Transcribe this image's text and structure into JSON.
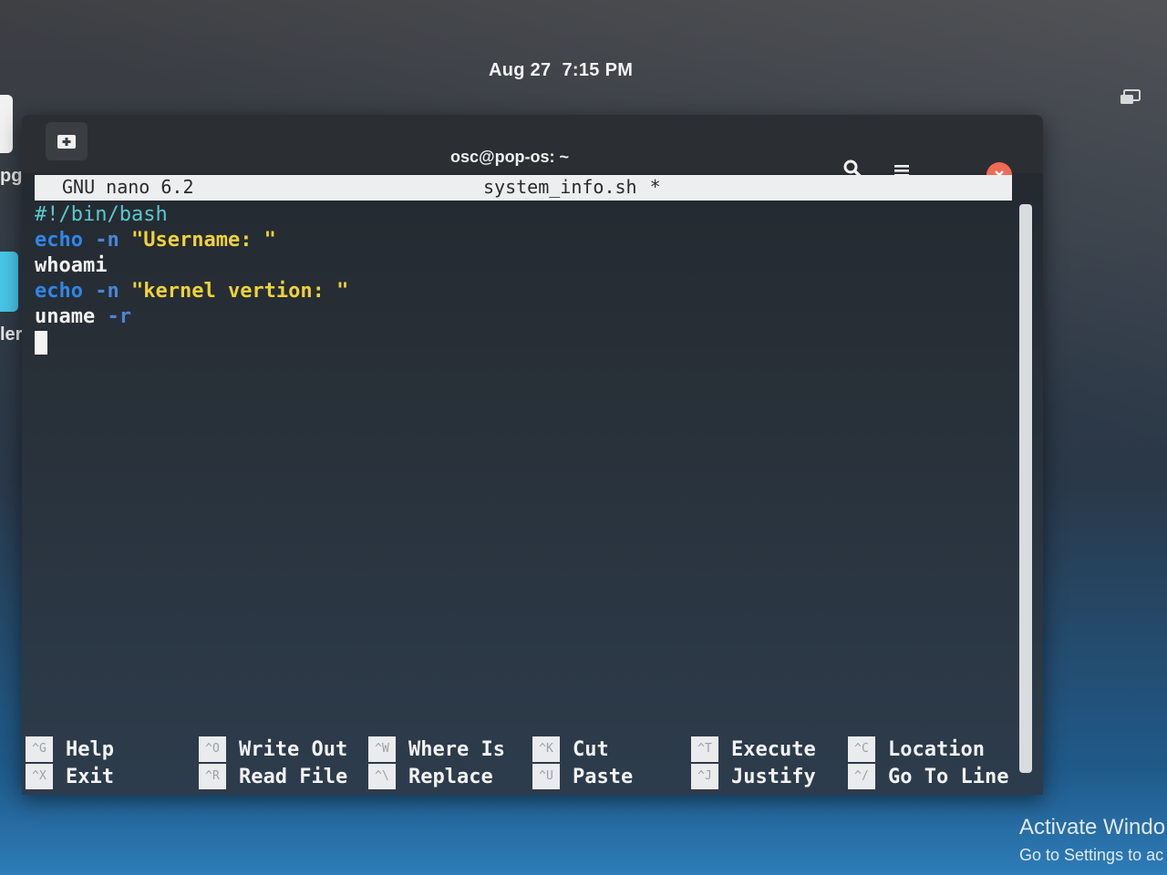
{
  "topbar": {
    "date": "Aug 27",
    "time": "7:15 PM"
  },
  "desktop": {
    "labels": [
      "pg",
      "ler"
    ]
  },
  "window": {
    "title": "osc@pop-os: ~"
  },
  "nano": {
    "version": "GNU nano 6.2",
    "filename": "system_info.sh",
    "modified_marker": "*",
    "lines": [
      [
        {
          "t": "#!/bin/bash",
          "c": "comment"
        }
      ],
      [
        {
          "t": "echo",
          "c": "kw"
        },
        {
          "t": " ",
          "c": "plain"
        },
        {
          "t": "-n",
          "c": "flag"
        },
        {
          "t": " ",
          "c": "plain"
        },
        {
          "t": "\"Username: \"",
          "c": "str"
        }
      ],
      [
        {
          "t": "whoami",
          "c": "plain"
        }
      ],
      [
        {
          "t": "echo",
          "c": "kw"
        },
        {
          "t": " ",
          "c": "plain"
        },
        {
          "t": "-n",
          "c": "flag"
        },
        {
          "t": " ",
          "c": "plain"
        },
        {
          "t": "\"kernel vertion: \"",
          "c": "str"
        }
      ],
      [
        {
          "t": "uname",
          "c": "plain"
        },
        {
          "t": " ",
          "c": "plain"
        },
        {
          "t": "-r",
          "c": "flag"
        }
      ]
    ],
    "shortcuts": [
      {
        "top": {
          "key": "^G",
          "label": "Help"
        },
        "bottom": {
          "key": "^X",
          "label": "Exit"
        }
      },
      {
        "top": {
          "key": "^O",
          "label": "Write Out"
        },
        "bottom": {
          "key": "^R",
          "label": "Read File"
        }
      },
      {
        "top": {
          "key": "^W",
          "label": "Where Is"
        },
        "bottom": {
          "key": "^\\",
          "label": "Replace"
        }
      },
      {
        "top": {
          "key": "^K",
          "label": "Cut"
        },
        "bottom": {
          "key": "^U",
          "label": "Paste"
        }
      },
      {
        "top": {
          "key": "^T",
          "label": "Execute"
        },
        "bottom": {
          "key": "^J",
          "label": "Justify"
        }
      },
      {
        "top": {
          "key": "^C",
          "label": "Location"
        },
        "bottom": {
          "key": "^/",
          "label": "Go To Line"
        }
      }
    ]
  },
  "watermark": {
    "title": "Activate Windo",
    "subtitle": "Go to Settings to ac"
  },
  "colors": {
    "keyword": "#2f86e8",
    "string": "#f0d23a",
    "comment": "#5cc8d0",
    "close_button": "#f06a55"
  },
  "icons": {
    "new_tab": "new-tab-icon",
    "search": "search-icon",
    "menu": "hamburger-menu-icon",
    "minimize": "minimize-icon",
    "close": "close-icon",
    "tray": "display-icon"
  }
}
